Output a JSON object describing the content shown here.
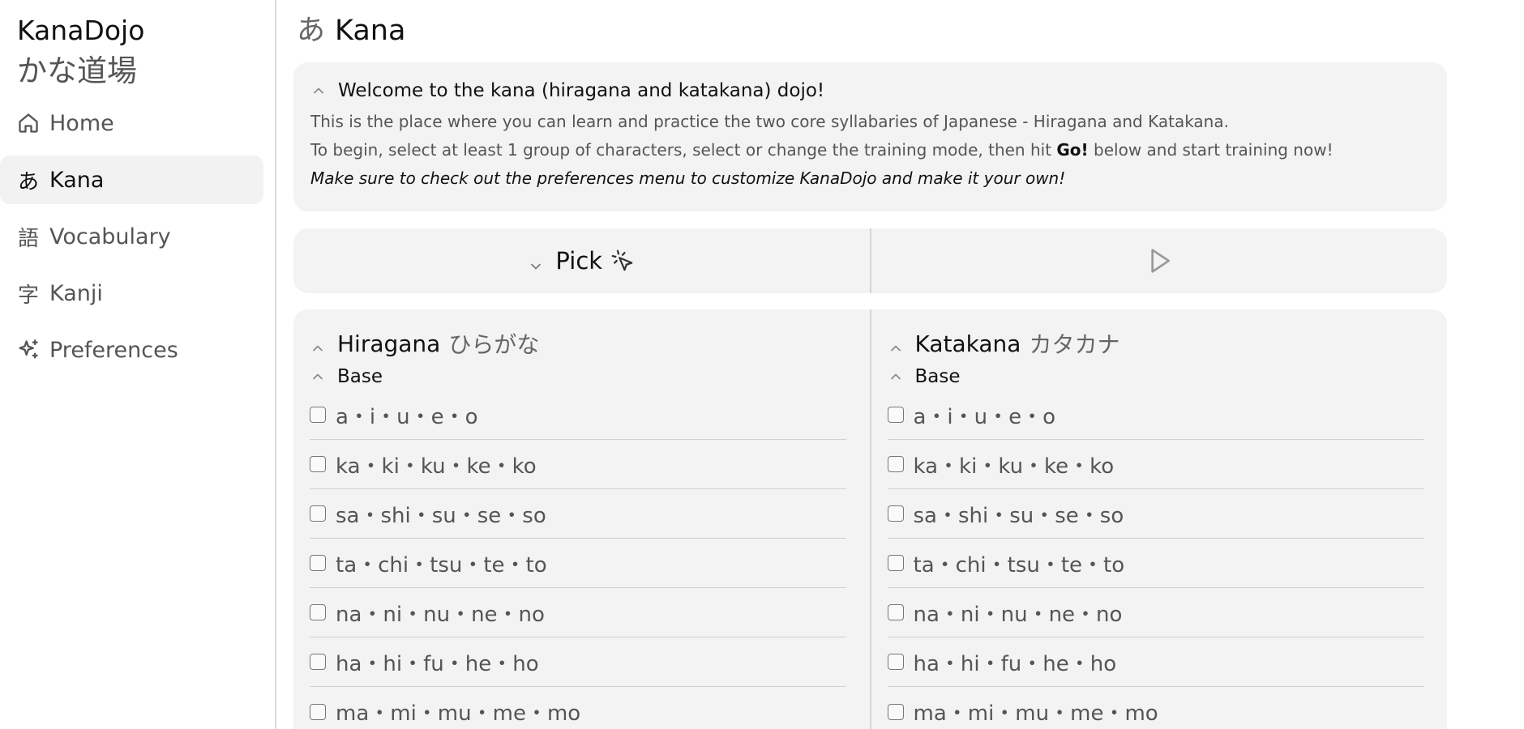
{
  "brand": {
    "name": "KanaDojo",
    "name_jp": "かな道場"
  },
  "nav": {
    "items": [
      {
        "icon": "house-icon",
        "label": "Home",
        "active": false
      },
      {
        "icon": "hiragana-a-icon",
        "glyph": "あ",
        "label": "Kana",
        "active": true
      },
      {
        "icon": "vocabulary-glyph-icon",
        "glyph": "語",
        "label": "Vocabulary",
        "active": false
      },
      {
        "icon": "kanji-glyph-icon",
        "glyph": "字",
        "label": "Kanji",
        "active": false
      },
      {
        "icon": "sparkles-icon",
        "label": "Preferences",
        "active": false
      }
    ]
  },
  "page": {
    "title_glyph": "あ",
    "title": "Kana"
  },
  "welcome": {
    "heading": "Welcome to the kana (hiragana and katakana) dojo!",
    "line1": "This is the place where you can learn and practice the two core syllabaries of Japanese - Hiragana and Katakana.",
    "line2_pre": "To begin, select at least 1 group of characters, select or change the training mode, then hit ",
    "line2_bold": "Go!",
    "line2_post": " below and start training now!",
    "line3": "Make sure to check out the preferences menu to customize KanaDojo and make it your own!"
  },
  "toolbar": {
    "pick_label": "Pick",
    "pick_icon": "mouse-pointer-click-icon",
    "play_icon": "play-icon"
  },
  "hiragana": {
    "title": "Hiragana",
    "title_jp": "ひらがな",
    "subgroup": "Base",
    "rows": [
      "a・i・u・e・o",
      "ka・ki・ku・ke・ko",
      "sa・shi・su・se・so",
      "ta・chi・tsu・te・to",
      "na・ni・nu・ne・no",
      "ha・hi・fu・he・ho",
      "ma・mi・mu・me・mo"
    ]
  },
  "katakana": {
    "title": "Katakana",
    "title_jp": "カタカナ",
    "subgroup": "Base",
    "rows": [
      "a・i・u・e・o",
      "ka・ki・ku・ke・ko",
      "sa・shi・su・se・so",
      "ta・chi・tsu・te・to",
      "na・ni・nu・ne・no",
      "ha・hi・fu・he・ho",
      "ma・mi・mu・me・mo"
    ]
  }
}
